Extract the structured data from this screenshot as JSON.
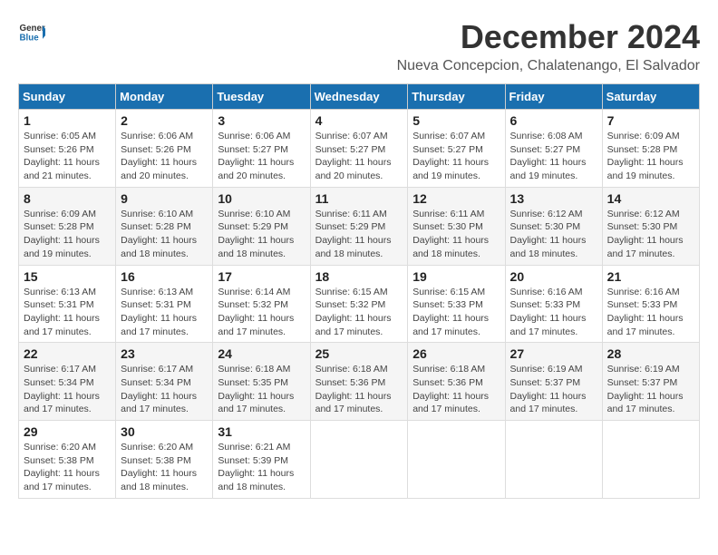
{
  "logo": {
    "general": "General",
    "blue": "Blue"
  },
  "title": "December 2024",
  "subtitle": "Nueva Concepcion, Chalatenango, El Salvador",
  "days_header": [
    "Sunday",
    "Monday",
    "Tuesday",
    "Wednesday",
    "Thursday",
    "Friday",
    "Saturday"
  ],
  "weeks": [
    [
      {
        "day": "1",
        "sunrise": "6:05 AM",
        "sunset": "5:26 PM",
        "daylight": "11 hours and 21 minutes."
      },
      {
        "day": "2",
        "sunrise": "6:06 AM",
        "sunset": "5:26 PM",
        "daylight": "11 hours and 20 minutes."
      },
      {
        "day": "3",
        "sunrise": "6:06 AM",
        "sunset": "5:27 PM",
        "daylight": "11 hours and 20 minutes."
      },
      {
        "day": "4",
        "sunrise": "6:07 AM",
        "sunset": "5:27 PM",
        "daylight": "11 hours and 20 minutes."
      },
      {
        "day": "5",
        "sunrise": "6:07 AM",
        "sunset": "5:27 PM",
        "daylight": "11 hours and 19 minutes."
      },
      {
        "day": "6",
        "sunrise": "6:08 AM",
        "sunset": "5:27 PM",
        "daylight": "11 hours and 19 minutes."
      },
      {
        "day": "7",
        "sunrise": "6:09 AM",
        "sunset": "5:28 PM",
        "daylight": "11 hours and 19 minutes."
      }
    ],
    [
      {
        "day": "8",
        "sunrise": "6:09 AM",
        "sunset": "5:28 PM",
        "daylight": "11 hours and 19 minutes."
      },
      {
        "day": "9",
        "sunrise": "6:10 AM",
        "sunset": "5:28 PM",
        "daylight": "11 hours and 18 minutes."
      },
      {
        "day": "10",
        "sunrise": "6:10 AM",
        "sunset": "5:29 PM",
        "daylight": "11 hours and 18 minutes."
      },
      {
        "day": "11",
        "sunrise": "6:11 AM",
        "sunset": "5:29 PM",
        "daylight": "11 hours and 18 minutes."
      },
      {
        "day": "12",
        "sunrise": "6:11 AM",
        "sunset": "5:30 PM",
        "daylight": "11 hours and 18 minutes."
      },
      {
        "day": "13",
        "sunrise": "6:12 AM",
        "sunset": "5:30 PM",
        "daylight": "11 hours and 18 minutes."
      },
      {
        "day": "14",
        "sunrise": "6:12 AM",
        "sunset": "5:30 PM",
        "daylight": "11 hours and 17 minutes."
      }
    ],
    [
      {
        "day": "15",
        "sunrise": "6:13 AM",
        "sunset": "5:31 PM",
        "daylight": "11 hours and 17 minutes."
      },
      {
        "day": "16",
        "sunrise": "6:13 AM",
        "sunset": "5:31 PM",
        "daylight": "11 hours and 17 minutes."
      },
      {
        "day": "17",
        "sunrise": "6:14 AM",
        "sunset": "5:32 PM",
        "daylight": "11 hours and 17 minutes."
      },
      {
        "day": "18",
        "sunrise": "6:15 AM",
        "sunset": "5:32 PM",
        "daylight": "11 hours and 17 minutes."
      },
      {
        "day": "19",
        "sunrise": "6:15 AM",
        "sunset": "5:33 PM",
        "daylight": "11 hours and 17 minutes."
      },
      {
        "day": "20",
        "sunrise": "6:16 AM",
        "sunset": "5:33 PM",
        "daylight": "11 hours and 17 minutes."
      },
      {
        "day": "21",
        "sunrise": "6:16 AM",
        "sunset": "5:33 PM",
        "daylight": "11 hours and 17 minutes."
      }
    ],
    [
      {
        "day": "22",
        "sunrise": "6:17 AM",
        "sunset": "5:34 PM",
        "daylight": "11 hours and 17 minutes."
      },
      {
        "day": "23",
        "sunrise": "6:17 AM",
        "sunset": "5:34 PM",
        "daylight": "11 hours and 17 minutes."
      },
      {
        "day": "24",
        "sunrise": "6:18 AM",
        "sunset": "5:35 PM",
        "daylight": "11 hours and 17 minutes."
      },
      {
        "day": "25",
        "sunrise": "6:18 AM",
        "sunset": "5:36 PM",
        "daylight": "11 hours and 17 minutes."
      },
      {
        "day": "26",
        "sunrise": "6:18 AM",
        "sunset": "5:36 PM",
        "daylight": "11 hours and 17 minutes."
      },
      {
        "day": "27",
        "sunrise": "6:19 AM",
        "sunset": "5:37 PM",
        "daylight": "11 hours and 17 minutes."
      },
      {
        "day": "28",
        "sunrise": "6:19 AM",
        "sunset": "5:37 PM",
        "daylight": "11 hours and 17 minutes."
      }
    ],
    [
      {
        "day": "29",
        "sunrise": "6:20 AM",
        "sunset": "5:38 PM",
        "daylight": "11 hours and 17 minutes."
      },
      {
        "day": "30",
        "sunrise": "6:20 AM",
        "sunset": "5:38 PM",
        "daylight": "11 hours and 18 minutes."
      },
      {
        "day": "31",
        "sunrise": "6:21 AM",
        "sunset": "5:39 PM",
        "daylight": "11 hours and 18 minutes."
      },
      null,
      null,
      null,
      null
    ]
  ],
  "labels": {
    "sunrise": "Sunrise: ",
    "sunset": "Sunset: ",
    "daylight": "Daylight: "
  }
}
